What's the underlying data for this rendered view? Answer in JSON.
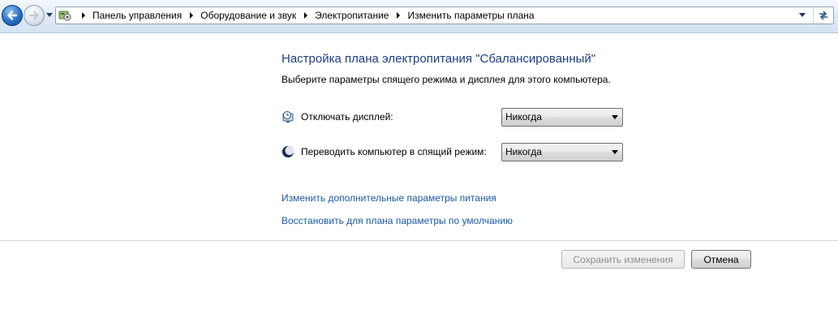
{
  "navigation": {
    "back_icon": "back-arrow-icon",
    "forward_icon": "forward-arrow-icon",
    "history_icon": "chevron-down-icon",
    "breadcrumbs": [
      "Панель управления",
      "Оборудование и звук",
      "Электропитание",
      "Изменить параметры плана"
    ],
    "location_icon": "control-panel-icon",
    "refresh_icon": "refresh-icon"
  },
  "main": {
    "title": "Настройка плана электропитания \"Сбалансированный\"",
    "subtitle": "Выберите параметры спящего режима и дисплея для этого компьютера.",
    "settings": [
      {
        "label": "Отключать дисплей:",
        "icon": "display-clock-icon",
        "value": "Никогда"
      },
      {
        "label": "Переводить компьютер в спящий режим:",
        "icon": "moon-icon",
        "value": "Никогда"
      }
    ],
    "links": [
      "Изменить дополнительные параметры питания",
      "Восстановить для плана параметры по умолчанию"
    ]
  },
  "footer": {
    "save_label": "Сохранить изменения",
    "save_enabled": false,
    "cancel_label": "Отмена"
  },
  "colors": {
    "title": "#1e3d87",
    "link": "#1a5ba8",
    "disabled_text": "#8d8d8d"
  }
}
